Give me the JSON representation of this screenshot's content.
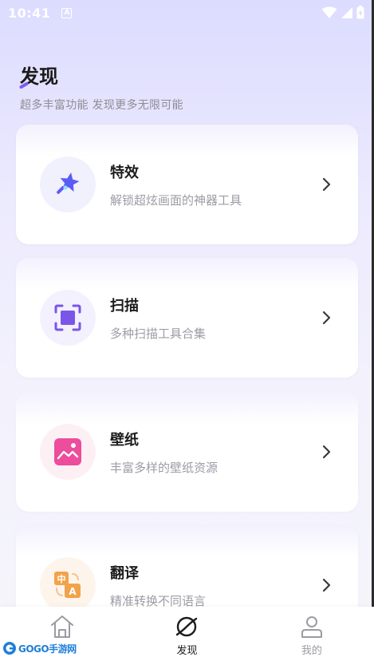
{
  "status_bar": {
    "time": "10:41",
    "notification_letter": "A"
  },
  "header": {
    "title": "发现",
    "subtitle": "超多丰富功能  发现更多无限可能"
  },
  "cards": [
    {
      "title": "特效",
      "desc": "解锁超炫画面的神器工具",
      "icon": "magic-star-icon",
      "bg": "#f1f0fd"
    },
    {
      "title": "扫描",
      "desc": "多种扫描工具合集",
      "icon": "scan-frame-icon",
      "bg": "#f3f1fd"
    },
    {
      "title": "壁纸",
      "desc": "丰富多样的壁纸资源",
      "icon": "wallpaper-image-icon",
      "bg": "#fdf0f5"
    },
    {
      "title": "翻译",
      "desc": "精准转换不同语言",
      "icon": "translate-icon",
      "bg": "#fdf4ec"
    }
  ],
  "bottom_nav": [
    {
      "label": "",
      "icon": "home-icon",
      "active": false
    },
    {
      "label": "发现",
      "icon": "discover-icon",
      "active": true
    },
    {
      "label": "我的",
      "icon": "profile-icon",
      "active": false
    }
  ],
  "watermark": {
    "text": "GOGO手游网"
  },
  "colors": {
    "accent": "#7b5cf0",
    "magic": "#5b5cf6",
    "scan": "#7a56e8",
    "wallpaper": "#ec4d9c",
    "translate": "#f2a24a"
  }
}
